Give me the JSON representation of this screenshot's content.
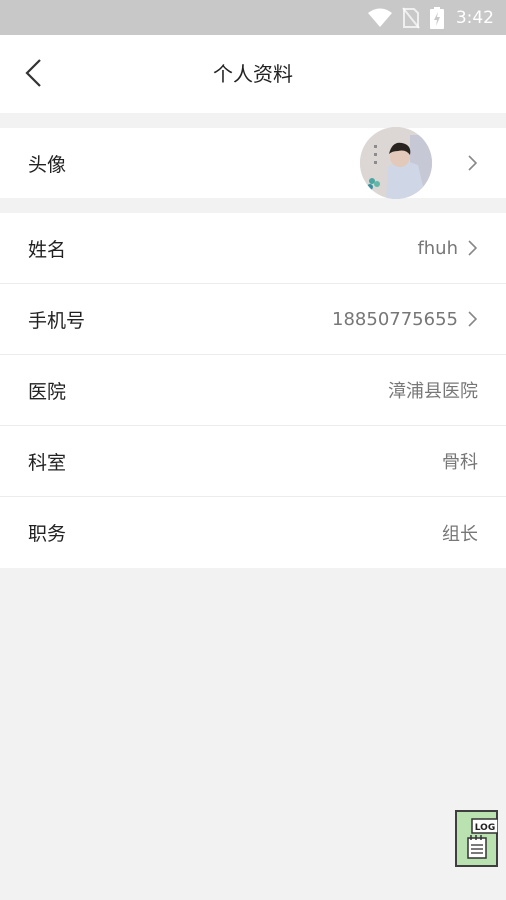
{
  "status_bar": {
    "time": "3:42"
  },
  "header": {
    "title": "个人资料"
  },
  "avatar_row": {
    "label": "头像"
  },
  "profile_rows": [
    {
      "label": "姓名",
      "value": "fhuh"
    },
    {
      "label": "手机号",
      "value": "18850775655"
    },
    {
      "label": "医院",
      "value": "漳浦县医院"
    },
    {
      "label": "科室",
      "value": "骨科"
    },
    {
      "label": "职务",
      "value": "组长"
    }
  ],
  "log_button": {
    "label": "LOG"
  }
}
